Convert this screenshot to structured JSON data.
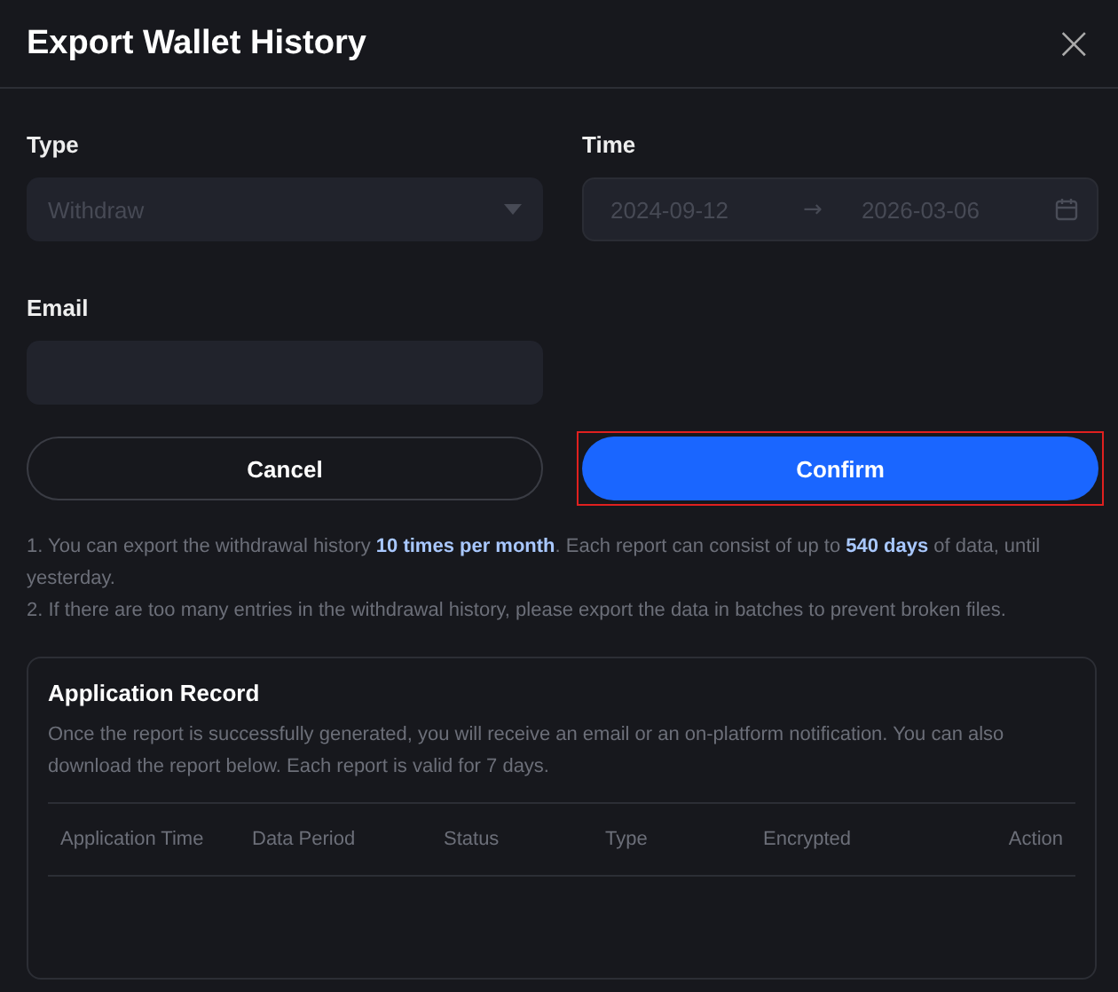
{
  "dialog": {
    "title": "Export Wallet History",
    "close_icon": "×"
  },
  "type_field": {
    "label": "Type",
    "value": "Withdraw",
    "disabled": true
  },
  "time_field": {
    "label": "Time",
    "start": "2024-09-12",
    "arrow": "→",
    "end": "2026-03-06",
    "disabled": true
  },
  "email_field": {
    "label": "Email"
  },
  "buttons": [
    {
      "label": "Cancel",
      "kind": "secondary",
      "highlighted": false
    },
    {
      "label": "Confirm",
      "kind": "primary",
      "highlighted": true
    }
  ],
  "notes": [
    "1. You can export the withdrawal history **10 times per month**. Each report can consist of up to **540 days** of data, until yesterday.",
    "2. If there are too many entries in the withdrawal history, please export the data in batches to prevent broken files."
  ],
  "record": {
    "title": "Application Record",
    "description": "Once the report is successfully generated, you will receive an email or an on-platform notification. You can also download the report below. Each report is valid for 7 days.",
    "columns": [
      "Application Time",
      "Data Period",
      "Status",
      "Type",
      "Encrypted",
      "Action"
    ]
  }
}
